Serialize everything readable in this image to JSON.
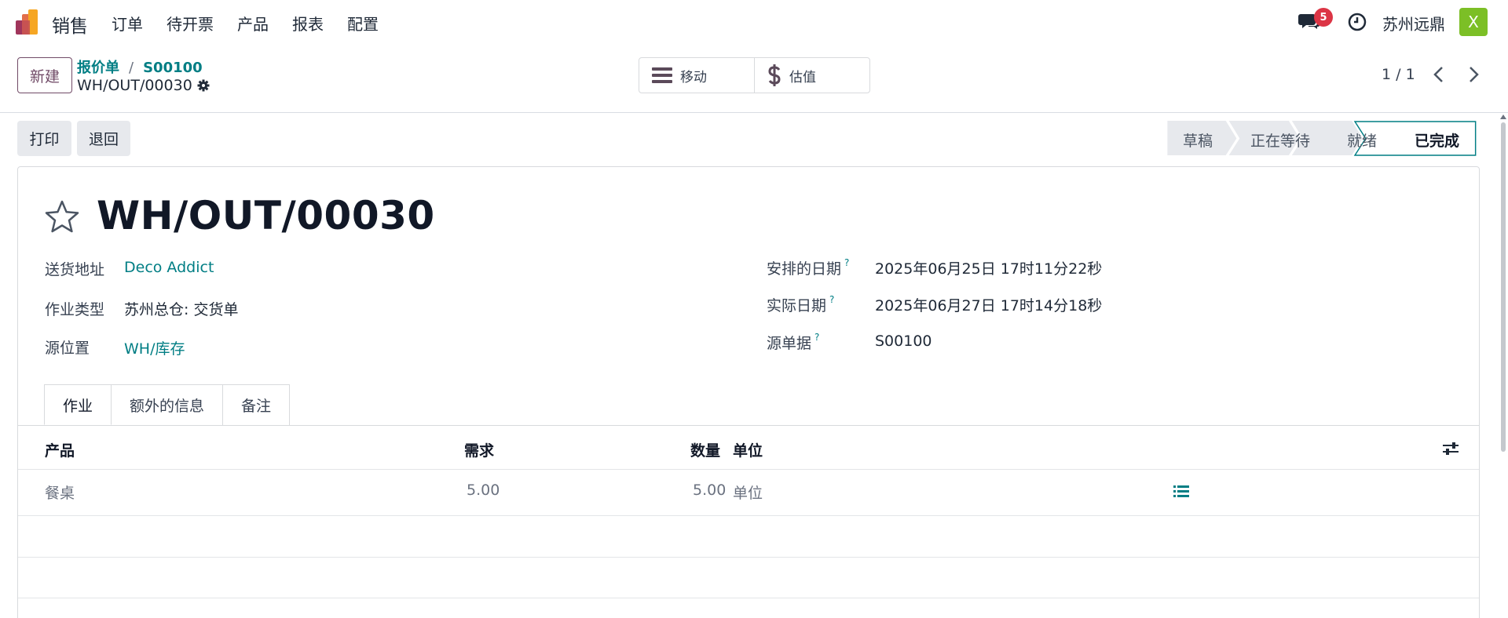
{
  "topbar": {
    "app_name": "销售",
    "menu": [
      "订单",
      "待开票",
      "产品",
      "报表",
      "配置"
    ],
    "chat_badge": "5",
    "company": "苏州远鼎",
    "avatar_letter": "X"
  },
  "control": {
    "new_label": "新建",
    "breadcrumb": [
      "报价单",
      "S00100"
    ],
    "record_name": "WH/OUT/00030",
    "actions": [
      {
        "label": "移动",
        "icon": "hamburger-icon"
      },
      {
        "label": "估值",
        "icon": "dollar-icon"
      }
    ],
    "pager": "1 / 1"
  },
  "buttons": {
    "print": "打印",
    "return": "退回"
  },
  "status": {
    "steps": [
      "草稿",
      "正在等待",
      "就绪",
      "已完成"
    ],
    "current": "已完成"
  },
  "form": {
    "title": "WH/OUT/00030",
    "left": [
      {
        "label": "送货地址",
        "value": "Deco Addict",
        "link": true
      },
      {
        "label": "作业类型",
        "value": "苏州总仓: 交货单",
        "link": false
      },
      {
        "label": "源位置",
        "value": "WH/库存",
        "link": true
      }
    ],
    "right": [
      {
        "label": "安排的日期",
        "help": "?",
        "value": "2025年06月25日 17时11分22秒"
      },
      {
        "label": "实际日期",
        "help": "?",
        "value": "2025年06月27日 17时14分18秒"
      },
      {
        "label": "源单据",
        "help": "?",
        "value": "S00100"
      }
    ]
  },
  "tabs": [
    "作业",
    "额外的信息",
    "备注"
  ],
  "table": {
    "headers": {
      "product": "产品",
      "demand": "需求",
      "quantity": "数量",
      "uom": "单位"
    },
    "rows": [
      {
        "product": "餐桌",
        "demand": "5.00",
        "quantity": "5.00",
        "uom": "单位"
      }
    ]
  },
  "colors": {
    "brand": "#714b67",
    "link": "#017e84",
    "badge": "#dc3545",
    "avatar": "#7cbf26"
  }
}
